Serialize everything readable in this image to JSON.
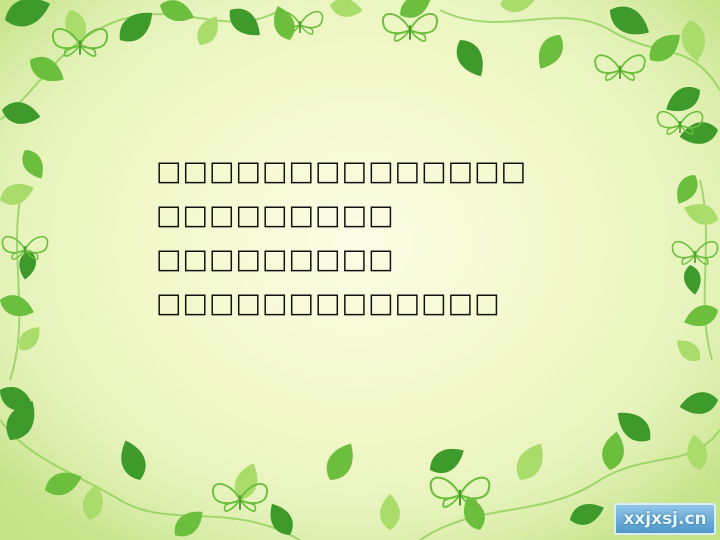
{
  "slide": {
    "lines": [
      "□□□□□□□□□□□□□□",
      "□□□□□□□□□",
      "□□□□□□□□□",
      "□□□□□□□□□□□□□"
    ]
  },
  "watermark": {
    "text": "xxjxsj.cn"
  },
  "colors": {
    "leaf_dark": "#3f9a2c",
    "leaf_mid": "#6cbf3c",
    "leaf_light": "#a9dc6a",
    "background_center": "#fbfde6",
    "background_edge": "#cfe897"
  },
  "decorations": [
    "leaf-border",
    "butterfly-icon"
  ]
}
